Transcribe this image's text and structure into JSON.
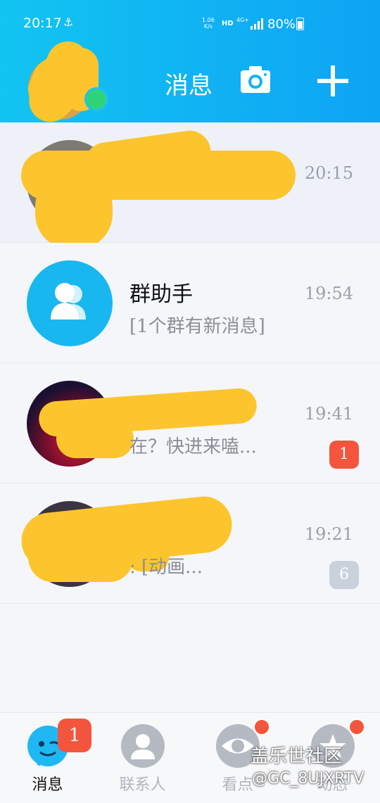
{
  "status_bar": {
    "time": "20:17",
    "speed": "1.06\nK/s",
    "hd": "HD",
    "network": "4G+",
    "battery": "80%"
  },
  "header": {
    "title": "消息"
  },
  "chats": [
    {
      "name": "",
      "preview": "",
      "time": "20:15",
      "badge": ""
    },
    {
      "name": "群助手",
      "preview": "[1个群有新消息]",
      "time": "19:54",
      "badge": ""
    },
    {
      "name": "",
      "preview": "在？快进来嗑...",
      "time": "19:41",
      "badge": "1"
    },
    {
      "name": "",
      "preview": ": [动画...",
      "time": "19:21",
      "badge": "6"
    }
  ],
  "tabs": [
    {
      "label": "消息",
      "badge": "1"
    },
    {
      "label": "联系人"
    },
    {
      "label": "看点"
    },
    {
      "label": "动态"
    }
  ],
  "watermark": {
    "line1": "盖乐世社区",
    "line2": "@GC_8UJXRTV"
  },
  "colors": {
    "header_start": "#12c4f2",
    "header_end": "#0ea4f4",
    "badge_red": "#f4553d",
    "badge_grey": "#c9d1dc"
  }
}
